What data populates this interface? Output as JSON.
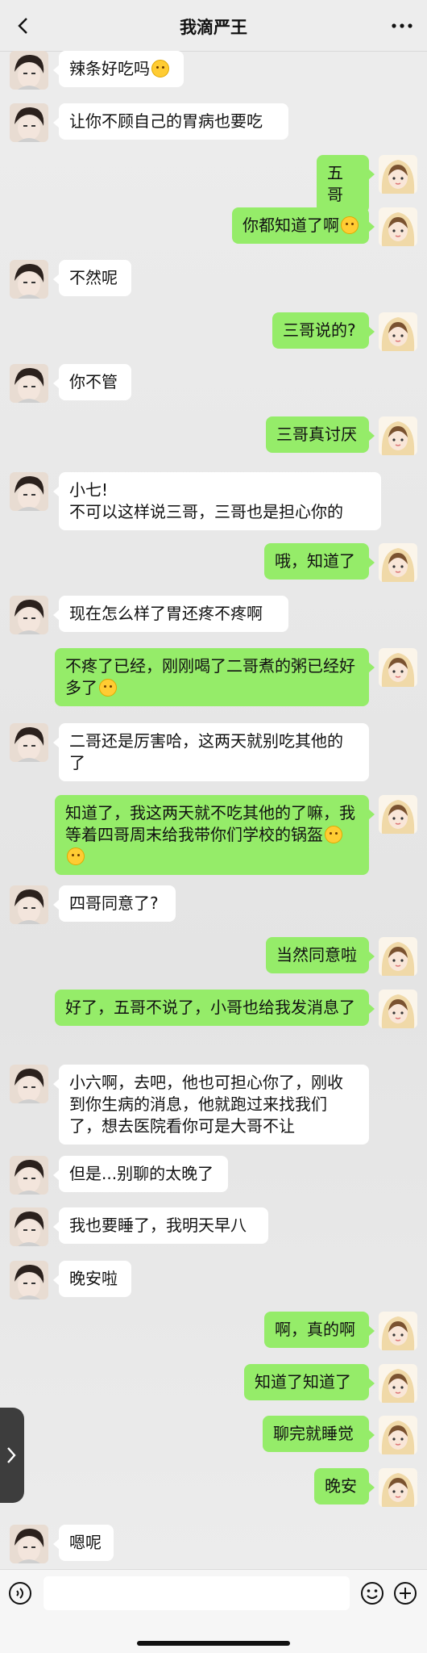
{
  "header": {
    "title": "我滴严王"
  },
  "colors": {
    "sent_bubble": "#95ec69",
    "received_bubble": "#ffffff",
    "background": "#ededed"
  },
  "icons": {
    "back": "chevron-left-icon",
    "more": "more-dots-icon",
    "voice": "voice-icon",
    "emoji": "emoji-face-icon",
    "plus": "plus-circle-icon"
  },
  "messages": [
    {
      "side": "left",
      "text": "辣条好吃吗",
      "emoji": 1
    },
    {
      "side": "left",
      "text": "让你不顾自己的胃病也要吃",
      "emoji": 0
    },
    {
      "side": "right",
      "text": "五哥",
      "emoji": 0
    },
    {
      "side": "right",
      "text": "你都知道了啊",
      "emoji": 1
    },
    {
      "side": "left",
      "text": "不然呢",
      "emoji": 0
    },
    {
      "side": "right",
      "text": "三哥说的?",
      "emoji": 0
    },
    {
      "side": "left",
      "text": "你不管",
      "emoji": 0
    },
    {
      "side": "right",
      "text": "三哥真讨厌",
      "emoji": 0
    },
    {
      "side": "left",
      "text": "小七!\n不可以这样说三哥，三哥也是担心你的",
      "emoji": 0
    },
    {
      "side": "right",
      "text": "哦，知道了",
      "emoji": 0
    },
    {
      "side": "left",
      "text": "现在怎么样了胃还疼不疼啊",
      "emoji": 0
    },
    {
      "side": "right",
      "text": "不疼了已经，刚刚喝了二哥煮的粥已经好多了",
      "emoji": 1
    },
    {
      "side": "left",
      "text": "二哥还是厉害哈，这两天就别吃其他的了",
      "emoji": 0
    },
    {
      "side": "right",
      "text": "知道了，我这两天就不吃其他的了嘛，我等着四哥周末给我带你们学校的锅盔",
      "emoji": 2
    },
    {
      "side": "left",
      "text": "四哥同意了?",
      "emoji": 0
    },
    {
      "side": "right",
      "text": "当然同意啦",
      "emoji": 0
    },
    {
      "side": "right",
      "text": "好了，五哥不说了，小哥也给我发消息了",
      "emoji": 0
    },
    {
      "side": "left",
      "text": "小六啊，去吧，他也可担心你了，刚收到你生病的消息，他就跑过来找我们了，想去医院看你可是大哥不让",
      "emoji": 0
    },
    {
      "side": "left",
      "text": "但是...别聊的太晚了",
      "emoji": 0
    },
    {
      "side": "left",
      "text": "我也要睡了，我明天早八",
      "emoji": 0
    },
    {
      "side": "left",
      "text": "晚安啦",
      "emoji": 0
    },
    {
      "side": "right",
      "text": "啊，真的啊",
      "emoji": 0
    },
    {
      "side": "right",
      "text": "知道了知道了",
      "emoji": 0
    },
    {
      "side": "right",
      "text": "聊完就睡觉",
      "emoji": 0
    },
    {
      "side": "right",
      "text": "晚安",
      "emoji": 0
    },
    {
      "side": "left",
      "text": "嗯呢",
      "emoji": 0
    }
  ],
  "input": {
    "value": "",
    "placeholder": ""
  }
}
